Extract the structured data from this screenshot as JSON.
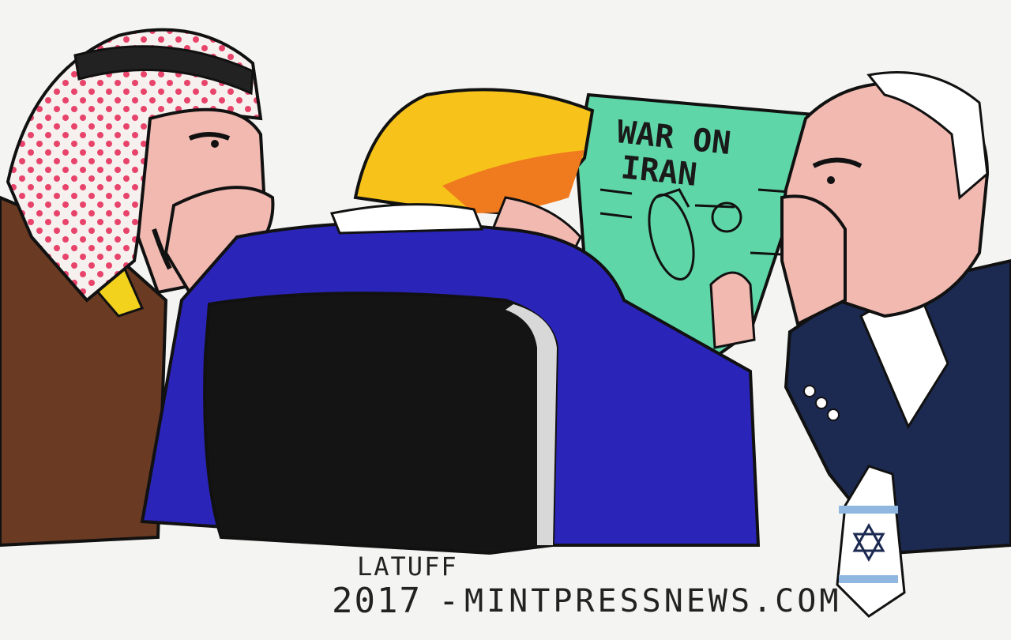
{
  "cartoon": {
    "scroll_title_line1": "WAR ON",
    "scroll_title_line2": "IRAN",
    "signature_artist": "LATUFF",
    "signature_year": "2017",
    "signature_dash": "-",
    "signature_site": "MINTPRESSNEWS.COM",
    "colors": {
      "background": "#f4f4f2",
      "jacket_blue": "#2a24b8",
      "chair_black": "#141414",
      "hair_yellow": "#f7c31a",
      "hair_orange": "#f07a1e",
      "scroll_green": "#5fd6a8",
      "thobe_brown": "#6a3a22",
      "headscarf_dots": "#e8446b",
      "suit_navy": "#1c2a52",
      "skin": "#f1b9b0"
    }
  }
}
